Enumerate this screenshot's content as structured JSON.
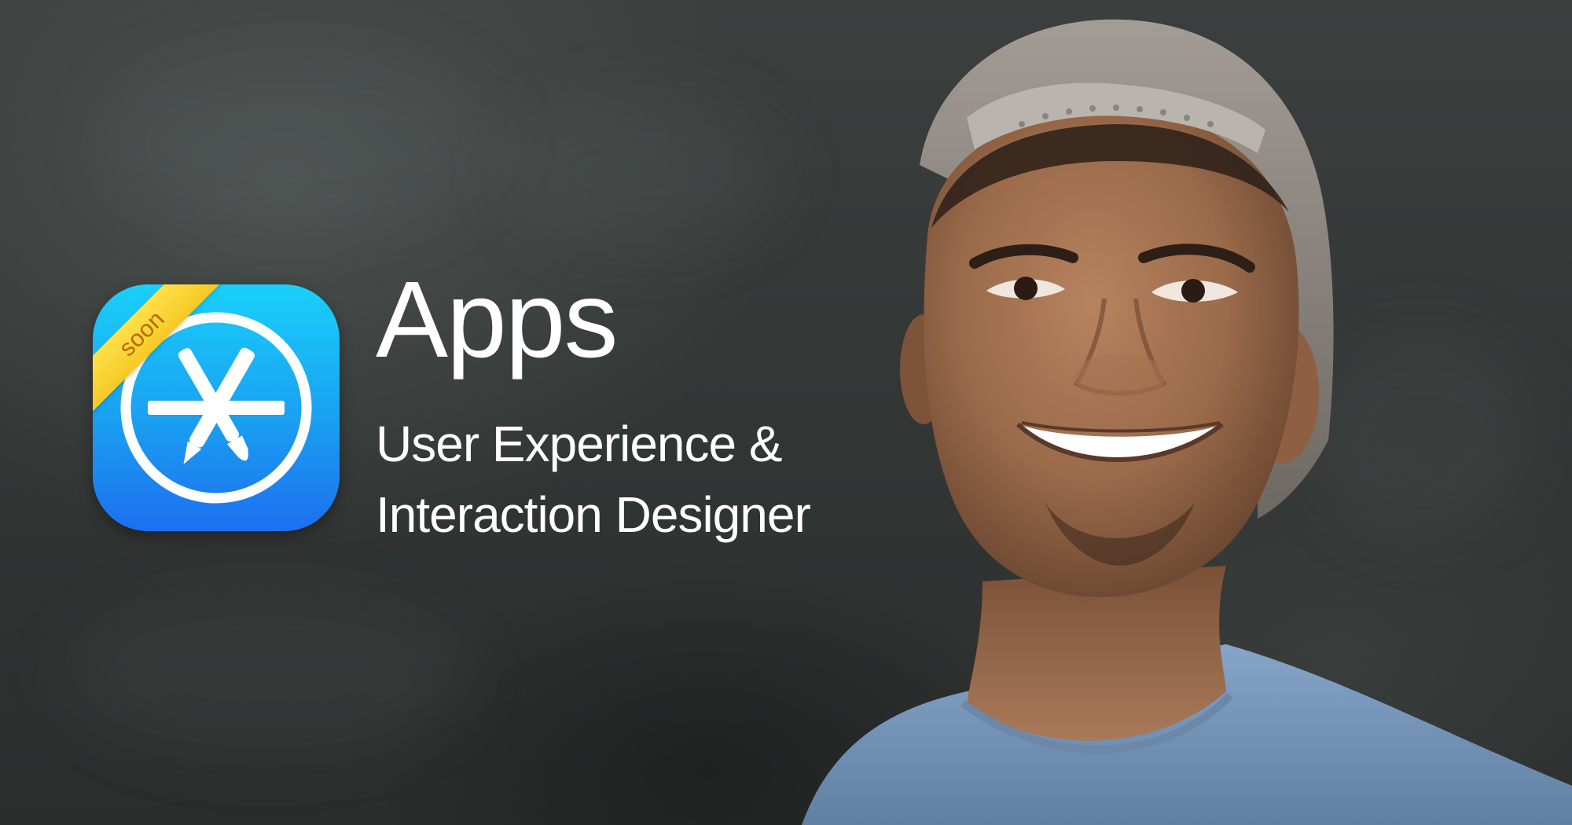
{
  "icon": {
    "ribbon_label": "soon",
    "ribbon_color": "#f6c925",
    "gradient_top": "#1ad0fb",
    "gradient_bottom": "#1d6ff0"
  },
  "heading": {
    "title": "Apps",
    "subtitle_line1": "User Experience &",
    "subtitle_line2": "Interaction Designer"
  },
  "colors": {
    "background": "#333736",
    "text": "#ffffff",
    "shirt": "#7d9cc0",
    "cap": "#8f8882"
  }
}
